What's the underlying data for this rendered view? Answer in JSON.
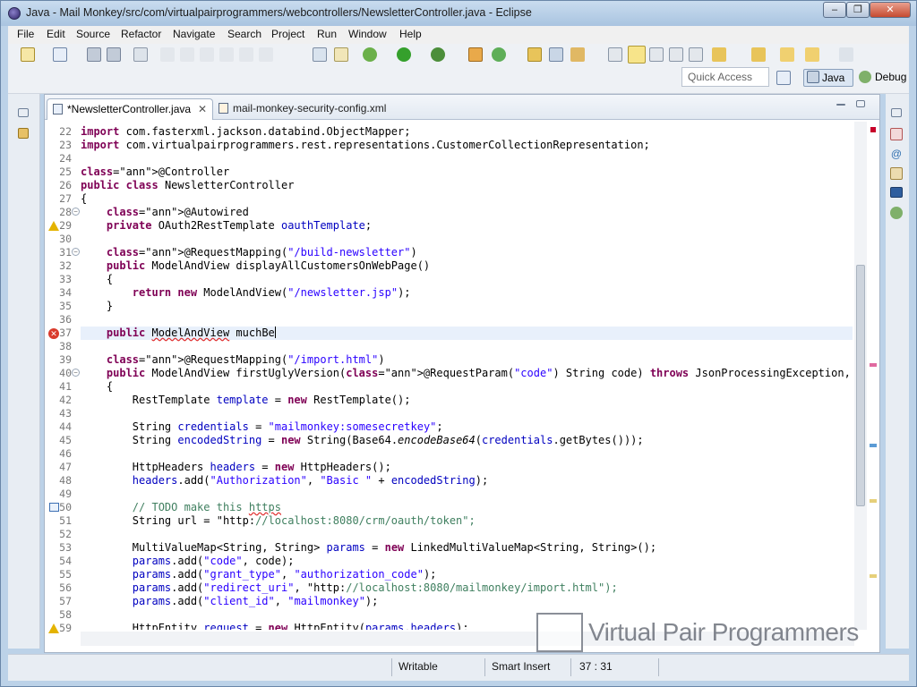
{
  "window": {
    "title": "Java - Mail Monkey/src/com/virtualpairprogrammers/webcontrollers/NewsletterController.java - Eclipse",
    "min": "‒",
    "max": "❐",
    "close": "✕"
  },
  "menu": [
    "File",
    "Edit",
    "Source",
    "Refactor",
    "Navigate",
    "Search",
    "Project",
    "Run",
    "Window",
    "Help"
  ],
  "toolbar": {
    "quick_access_placeholder": "Quick Access",
    "perspective_java": "Java",
    "perspective_debug": "Debug"
  },
  "tabs": [
    {
      "label": "*NewsletterController.java",
      "close": "✕"
    },
    {
      "label": "mail-monkey-security-config.xml"
    }
  ],
  "code_lines": [
    {
      "n": "22",
      "text": "import com.fasterxml.jackson.databind.ObjectMapper;"
    },
    {
      "n": "23",
      "text": "import com.virtualpairprogrammers.rest.representations.CustomerCollectionRepresentation;"
    },
    {
      "n": "24",
      "text": ""
    },
    {
      "n": "25",
      "text": "@Controller"
    },
    {
      "n": "26",
      "text": "public class NewsletterController"
    },
    {
      "n": "27",
      "text": "{"
    },
    {
      "n": "28",
      "text": "    @Autowired"
    },
    {
      "n": "29",
      "text": "    private OAuth2RestTemplate oauthTemplate;"
    },
    {
      "n": "30",
      "text": ""
    },
    {
      "n": "31",
      "text": "    @RequestMapping(\"/build-newsletter\")"
    },
    {
      "n": "32",
      "text": "    public ModelAndView displayAllCustomersOnWebPage()"
    },
    {
      "n": "33",
      "text": "    {"
    },
    {
      "n": "34",
      "text": "        return new ModelAndView(\"/newsletter.jsp\");"
    },
    {
      "n": "35",
      "text": "    }"
    },
    {
      "n": "36",
      "text": ""
    },
    {
      "n": "37",
      "text": "    public ModelAndView muchBe"
    },
    {
      "n": "38",
      "text": ""
    },
    {
      "n": "39",
      "text": "    @RequestMapping(\"/import.html\")"
    },
    {
      "n": "40",
      "text": "    public ModelAndView firstUglyVersion(@RequestParam(\"code\") String code) throws JsonProcessingException, IOException"
    },
    {
      "n": "41",
      "text": "    {"
    },
    {
      "n": "42",
      "text": "        RestTemplate template = new RestTemplate();"
    },
    {
      "n": "43",
      "text": ""
    },
    {
      "n": "44",
      "text": "        String credentials = \"mailmonkey:somesecretkey\";"
    },
    {
      "n": "45",
      "text": "        String encodedString = new String(Base64.encodeBase64(credentials.getBytes()));"
    },
    {
      "n": "46",
      "text": ""
    },
    {
      "n": "47",
      "text": "        HttpHeaders headers = new HttpHeaders();"
    },
    {
      "n": "48",
      "text": "        headers.add(\"Authorization\", \"Basic \" + encodedString);"
    },
    {
      "n": "49",
      "text": ""
    },
    {
      "n": "50",
      "text": "        // TODO make this https"
    },
    {
      "n": "51",
      "text": "        String url = \"http://localhost:8080/crm/oauth/token\";"
    },
    {
      "n": "52",
      "text": ""
    },
    {
      "n": "53",
      "text": "        MultiValueMap<String, String> params = new LinkedMultiValueMap<String, String>();"
    },
    {
      "n": "54",
      "text": "        params.add(\"code\", code);"
    },
    {
      "n": "55",
      "text": "        params.add(\"grant_type\", \"authorization_code\");"
    },
    {
      "n": "56",
      "text": "        params.add(\"redirect_uri\", \"http://localhost:8080/mailmonkey/import.html\");"
    },
    {
      "n": "57",
      "text": "        params.add(\"client_id\", \"mailmonkey\");"
    },
    {
      "n": "58",
      "text": ""
    },
    {
      "n": "59",
      "text": "        HttpEntity request = new HttpEntity(params,headers);"
    }
  ],
  "watermark": "Virtual Pair Programmers",
  "status": {
    "writable": "Writable",
    "insert_mode": "Smart Insert",
    "position": "37 : 31"
  },
  "colors": {
    "keyword": "#7f0055",
    "string": "#2a00ff",
    "annotation": "#646464",
    "comment": "#3f7f5f",
    "field": "#0000c0",
    "error": "#d93a2b"
  }
}
